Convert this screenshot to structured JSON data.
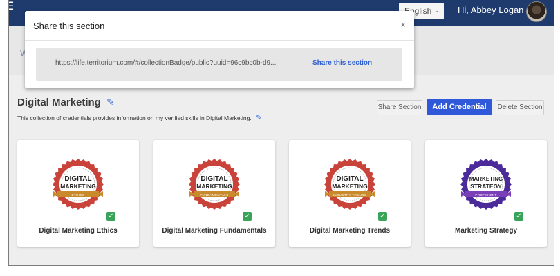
{
  "topbar": {
    "language": "English",
    "greeting": "Hi, Abbey Logan"
  },
  "subbar": {
    "truncated_label": "W"
  },
  "section": {
    "title": "Digital Marketing",
    "description": "This collection of credentials provides information on my verified skills in Digital Marketing.",
    "buttons": {
      "share": "Share Section",
      "add": "Add Credential",
      "delete": "Delete Section"
    },
    "cards": [
      {
        "label": "Digital Marketing Ethics",
        "badge": {
          "line1": "DIGITAL",
          "line2": "MARKETING",
          "ribbon": "ETHICS",
          "ring_color": "#c9433a",
          "ribbon_color": "#c88a2a"
        }
      },
      {
        "label": "Digital Marketing Fundamentals",
        "badge": {
          "line1": "DIGITAL",
          "line2": "MARKETING",
          "ribbon": "FUNDAMENTALS",
          "ring_color": "#c9433a",
          "ribbon_color": "#c88a2a"
        }
      },
      {
        "label": "Digital Marketing Trends",
        "badge": {
          "line1": "DIGITAL",
          "line2": "MARKETING",
          "ribbon": "INDUSTRY TRENDS",
          "ring_color": "#c9433a",
          "ribbon_color": "#c88a2a"
        }
      },
      {
        "label": "Marketing Strategy",
        "badge": {
          "line1": "MARKETING",
          "line2": "STRATEGY",
          "ribbon": "PROFICIENT",
          "ring_color": "#4b2a9a",
          "ribbon_color": "#7b3fb8"
        }
      }
    ]
  },
  "modal": {
    "title": "Share this section",
    "close": "×",
    "url": "https://life.territorium.com/#/collectionBadge/public?uuid=96c9bc0b-d9...",
    "share_link": "Share this section"
  },
  "colors": {
    "topbar": "#1f3b6e",
    "primary": "#2f59d9",
    "verified": "#3aa35a"
  }
}
